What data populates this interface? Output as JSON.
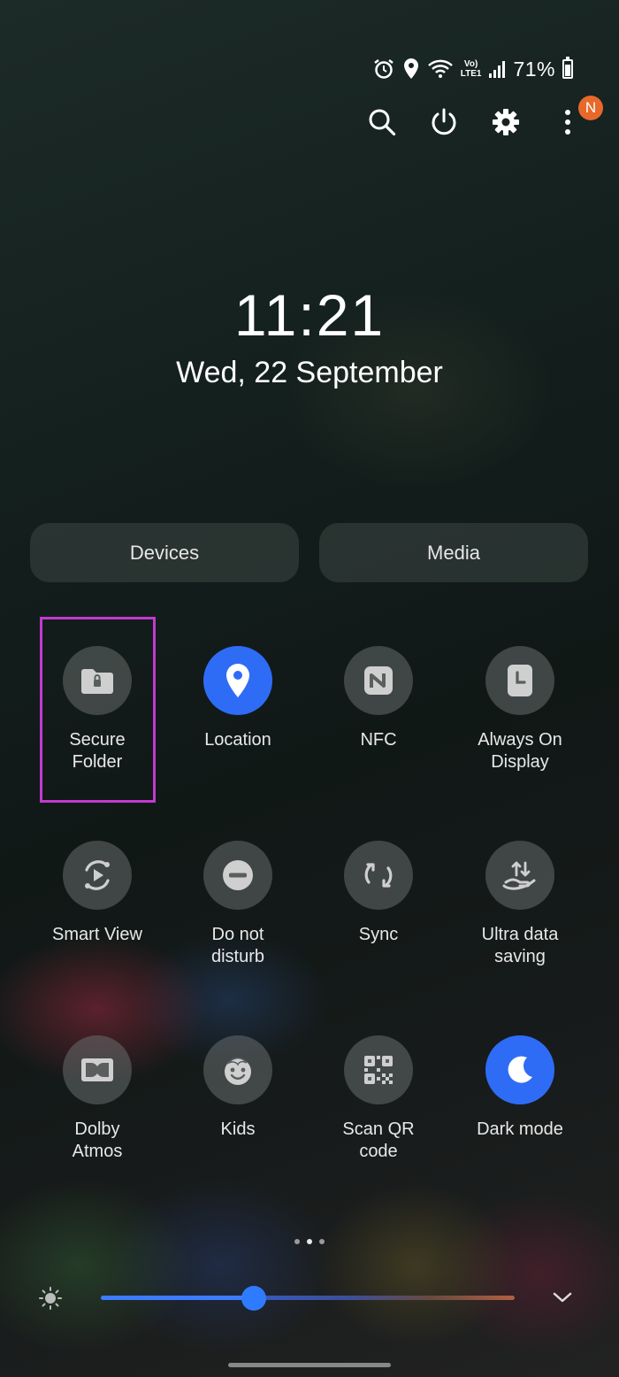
{
  "status_bar": {
    "icons": [
      "alarm-icon",
      "location-pin-icon",
      "wifi-icon",
      "volte-lte-icon",
      "signal-icon",
      "battery-icon"
    ],
    "volte_label": "Vo)",
    "lte_label": "LTE1",
    "battery_percent": "71%",
    "battery_level": 0.71
  },
  "top_actions": {
    "icons": [
      "search-icon",
      "power-icon",
      "gear-icon",
      "more-vert-icon"
    ],
    "notification_badge": "N",
    "badge_color": "#e8682a"
  },
  "lock": {
    "time": "11:21",
    "date": "Wed, 22 September"
  },
  "panels": {
    "devices_label": "Devices",
    "media_label": "Media"
  },
  "tiles": [
    {
      "label": "Secure\nFolder",
      "icon": "secure-folder-icon",
      "active": false
    },
    {
      "label": "Location",
      "icon": "location-pin-icon",
      "active": true
    },
    {
      "label": "NFC",
      "icon": "nfc-icon",
      "active": false
    },
    {
      "label": "Always On\nDisplay",
      "icon": "always-on-display-icon",
      "active": false
    },
    {
      "label": "Smart View",
      "icon": "smart-view-icon",
      "active": false
    },
    {
      "label": "Do not\ndisturb",
      "icon": "do-not-disturb-icon",
      "active": false
    },
    {
      "label": "Sync",
      "icon": "sync-icon",
      "active": false
    },
    {
      "label": "Ultra data\nsaving",
      "icon": "data-saving-icon",
      "active": false
    },
    {
      "label": "Dolby\nAtmos",
      "icon": "dolby-icon",
      "active": false
    },
    {
      "label": "Kids",
      "icon": "kids-icon",
      "active": false
    },
    {
      "label": "Scan QR\ncode",
      "icon": "qr-code-icon",
      "active": false
    },
    {
      "label": "Dark mode",
      "icon": "moon-icon",
      "active": true
    }
  ],
  "page_indicator": {
    "pages": 3,
    "current": 2
  },
  "brightness": {
    "level": 0.37
  },
  "colors": {
    "accent": "#2f6cf6",
    "highlight": "#c33ad0"
  }
}
